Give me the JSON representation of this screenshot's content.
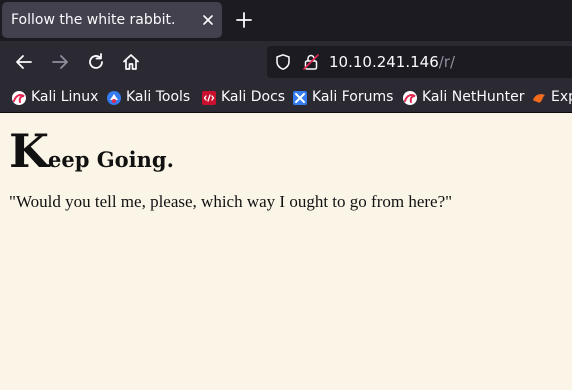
{
  "browser": {
    "tab": {
      "title": "Follow the white rabbit."
    },
    "url": {
      "host": "10.10.241.146",
      "path": "/r/"
    }
  },
  "bookmarks": [
    {
      "label": "Kali Linux",
      "icon": "kali-dragon-icon"
    },
    {
      "label": "Kali Tools",
      "icon": "kali-tools-icon"
    },
    {
      "label": "Kali Docs",
      "icon": "kali-docs-icon"
    },
    {
      "label": "Kali Forums",
      "icon": "kali-forums-icon"
    },
    {
      "label": "Kali NetHunter",
      "icon": "kali-nethunter-icon"
    },
    {
      "label": "Exp",
      "icon": "exploit-db-icon"
    }
  ],
  "page": {
    "heading_cap": "K",
    "heading_rest": "eep Going.",
    "quote": "\"Would you tell me, please, which way I ought to go from here?\""
  },
  "colors": {
    "page_background": "#fbf5e8",
    "toolbar": "#2b2a33",
    "tabstrip": "#1c1b22",
    "active_tab": "#42414d"
  }
}
